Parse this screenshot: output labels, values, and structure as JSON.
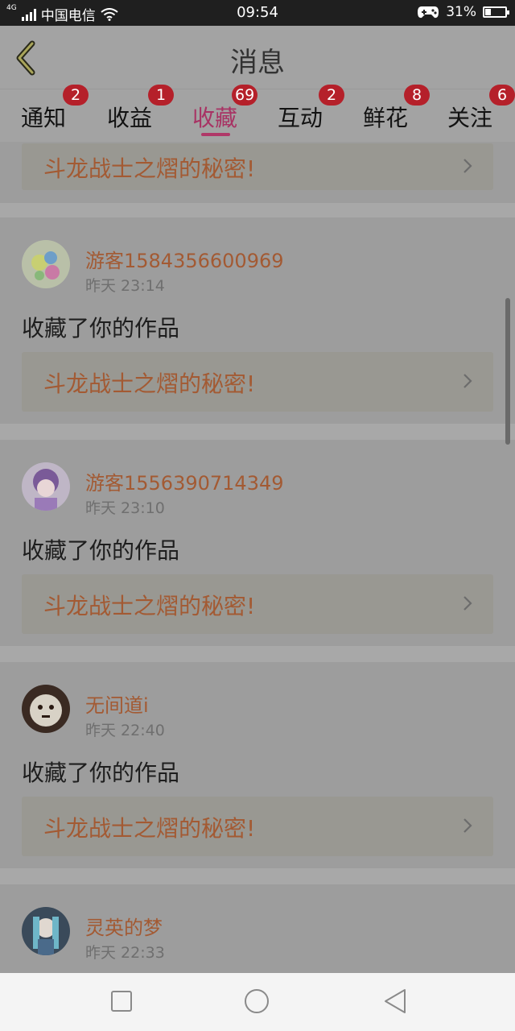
{
  "status_bar": {
    "network": "4G",
    "carrier": "中国电信",
    "time": "09:54",
    "battery": "31%",
    "battery_level": 0.31
  },
  "header": {
    "title": "消息"
  },
  "tabs": [
    {
      "label": "通知",
      "badge": "2"
    },
    {
      "label": "收益",
      "badge": "1"
    },
    {
      "label": "收藏",
      "badge": "69"
    },
    {
      "label": "互动",
      "badge": "2"
    },
    {
      "label": "鲜花",
      "badge": "8"
    },
    {
      "label": "关注",
      "badge": "6"
    }
  ],
  "active_tab": "收藏",
  "items": [
    {
      "work_title": "斗龙战士之熠的秘密!"
    },
    {
      "user": "游客1584356600969",
      "time": "昨天 23:14",
      "action": "收藏了你的作品",
      "work_title": "斗龙战士之熠的秘密!"
    },
    {
      "user": "游客1556390714349",
      "time": "昨天 23:10",
      "action": "收藏了你的作品",
      "work_title": "斗龙战士之熠的秘密!"
    },
    {
      "user": "无间道i",
      "time": "昨天 22:40",
      "action": "收藏了你的作品",
      "work_title": "斗龙战士之熠的秘密!"
    },
    {
      "user": "灵英的梦",
      "time": "昨天 22:33"
    }
  ],
  "colors": {
    "accent": "#a83364",
    "badge": "#b5202a",
    "username": "#a35a33"
  }
}
